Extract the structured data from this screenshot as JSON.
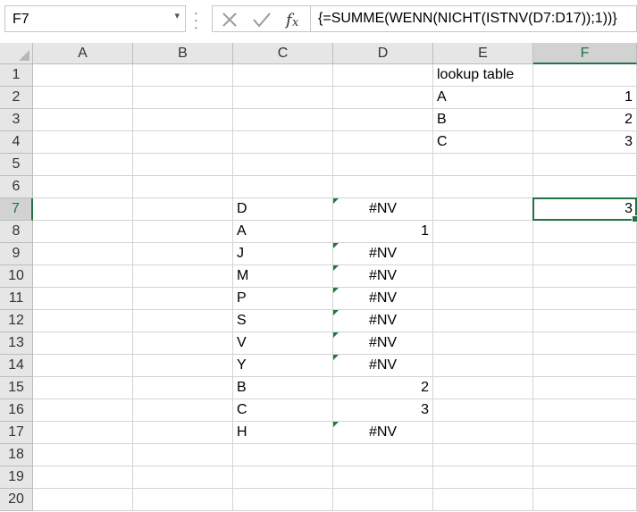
{
  "name_box": {
    "value": "F7"
  },
  "formula_bar": {
    "formula": "{=SUMME(WENN(NICHT(ISTNV(D7:D17));1))}",
    "cancel_icon": "cancel-x-icon",
    "enter_icon": "check-icon",
    "function_icon": "fx-icon"
  },
  "colors": {
    "accent": "#217346",
    "error_flag": "#1e7b34"
  },
  "columns": [
    "A",
    "B",
    "C",
    "D",
    "E",
    "F"
  ],
  "rows": [
    "1",
    "2",
    "3",
    "4",
    "5",
    "6",
    "7",
    "8",
    "9",
    "10",
    "11",
    "12",
    "13",
    "14",
    "15",
    "16",
    "17",
    "18",
    "19",
    "20"
  ],
  "selected": {
    "column": "F",
    "row": "7"
  },
  "cells": [
    {
      "ref": "E1",
      "value": "lookup table",
      "type": "text"
    },
    {
      "ref": "E2",
      "value": "A",
      "type": "text"
    },
    {
      "ref": "F2",
      "value": "1",
      "type": "number"
    },
    {
      "ref": "E3",
      "value": "B",
      "type": "text"
    },
    {
      "ref": "F3",
      "value": "2",
      "type": "number"
    },
    {
      "ref": "E4",
      "value": "C",
      "type": "text"
    },
    {
      "ref": "F4",
      "value": "3",
      "type": "number"
    },
    {
      "ref": "C7",
      "value": "D",
      "type": "text"
    },
    {
      "ref": "D7",
      "value": "#NV",
      "type": "error"
    },
    {
      "ref": "F7",
      "value": "3",
      "type": "number"
    },
    {
      "ref": "C8",
      "value": "A",
      "type": "text"
    },
    {
      "ref": "D8",
      "value": "1",
      "type": "number"
    },
    {
      "ref": "C9",
      "value": "J",
      "type": "text"
    },
    {
      "ref": "D9",
      "value": "#NV",
      "type": "error"
    },
    {
      "ref": "C10",
      "value": "M",
      "type": "text"
    },
    {
      "ref": "D10",
      "value": "#NV",
      "type": "error"
    },
    {
      "ref": "C11",
      "value": "P",
      "type": "text"
    },
    {
      "ref": "D11",
      "value": "#NV",
      "type": "error"
    },
    {
      "ref": "C12",
      "value": "S",
      "type": "text"
    },
    {
      "ref": "D12",
      "value": "#NV",
      "type": "error"
    },
    {
      "ref": "C13",
      "value": "V",
      "type": "text"
    },
    {
      "ref": "D13",
      "value": "#NV",
      "type": "error"
    },
    {
      "ref": "C14",
      "value": "Y",
      "type": "text"
    },
    {
      "ref": "D14",
      "value": "#NV",
      "type": "error"
    },
    {
      "ref": "C15",
      "value": "B",
      "type": "text"
    },
    {
      "ref": "D15",
      "value": "2",
      "type": "number"
    },
    {
      "ref": "C16",
      "value": "C",
      "type": "text"
    },
    {
      "ref": "D16",
      "value": "3",
      "type": "number"
    },
    {
      "ref": "C17",
      "value": "H",
      "type": "text"
    },
    {
      "ref": "D17",
      "value": "#NV",
      "type": "error"
    }
  ]
}
